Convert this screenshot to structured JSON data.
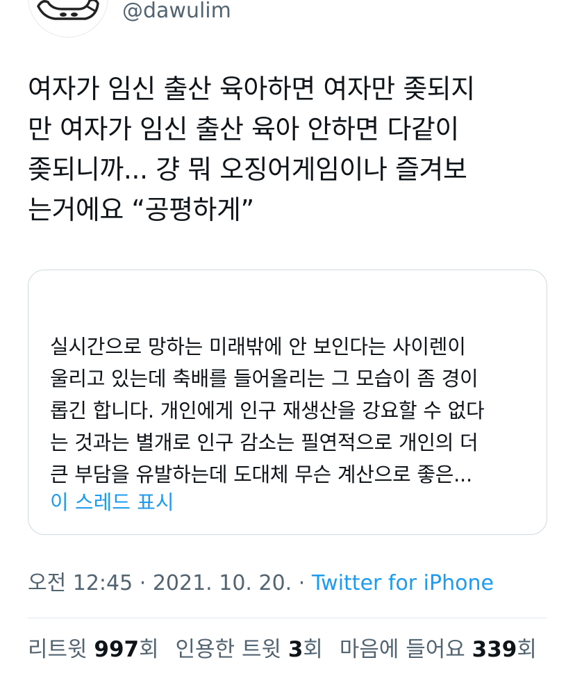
{
  "author": {
    "handle": "@dawulim",
    "avatar_icon": "cartoon-animal-avatar-icon"
  },
  "tweet": {
    "text": "여자가 임신 출산 육아하면 여자만 좆되지\n만 여자가 임신 출산 육아 안하면 다같이\n좆되니까... 걍 뭐 오징어게임이나 즐겨보\n는거에요 “공평하게”"
  },
  "quoted_tweet": {
    "text": "실시간으로 망하는 미래밖에 안 보인다는 사이렌이\n울리고 있는데 축배를 들어올리는 그 모습이 좀 경이\n롭긴 합니다. 개인에게 인구 재생산을 강요할 수 없다\n는 것과는 별개로 인구 감소는 필연적으로 개인의 더\n큰 부담을 유발하는데 도대체 무슨 계산으로 좋은...",
    "show_thread_label": "이 스레드 표시"
  },
  "meta": {
    "time": "오전 12:45",
    "separator": " · ",
    "date": "2021. 10. 20.",
    "source": "Twitter for iPhone"
  },
  "stats": {
    "retweets_label": "리트윗 ",
    "retweets_count": "997",
    "retweets_unit": "회",
    "quotes_label": "인용한 트윗 ",
    "quotes_count": "3",
    "quotes_unit": "회",
    "likes_label": "마음에 들어요 ",
    "likes_count": "339",
    "likes_unit": "회"
  },
  "colors": {
    "link": "#1d9bf0",
    "secondary_text": "#536471",
    "primary_text": "#0f1419",
    "border": "#cfd9de"
  }
}
